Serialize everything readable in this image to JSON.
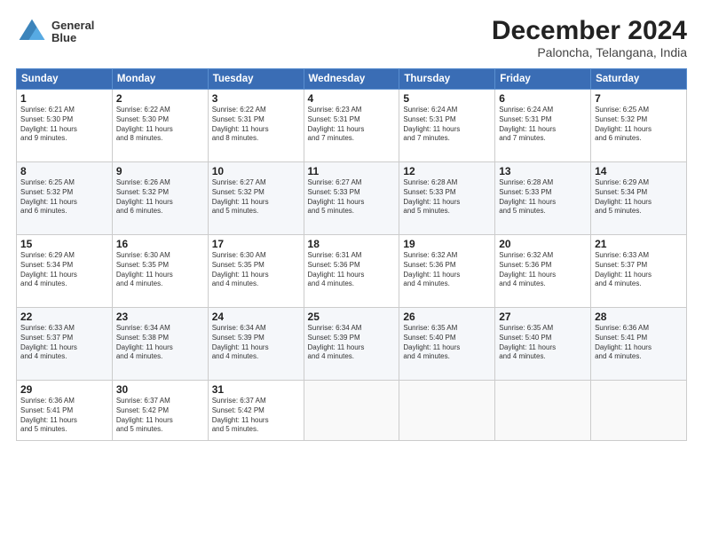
{
  "logo": {
    "line1": "General",
    "line2": "Blue"
  },
  "header": {
    "month": "December 2024",
    "location": "Paloncha, Telangana, India"
  },
  "weekdays": [
    "Sunday",
    "Monday",
    "Tuesday",
    "Wednesday",
    "Thursday",
    "Friday",
    "Saturday"
  ],
  "weeks": [
    [
      {
        "day": "1",
        "info": "Sunrise: 6:21 AM\nSunset: 5:30 PM\nDaylight: 11 hours\nand 9 minutes."
      },
      {
        "day": "2",
        "info": "Sunrise: 6:22 AM\nSunset: 5:30 PM\nDaylight: 11 hours\nand 8 minutes."
      },
      {
        "day": "3",
        "info": "Sunrise: 6:22 AM\nSunset: 5:31 PM\nDaylight: 11 hours\nand 8 minutes."
      },
      {
        "day": "4",
        "info": "Sunrise: 6:23 AM\nSunset: 5:31 PM\nDaylight: 11 hours\nand 7 minutes."
      },
      {
        "day": "5",
        "info": "Sunrise: 6:24 AM\nSunset: 5:31 PM\nDaylight: 11 hours\nand 7 minutes."
      },
      {
        "day": "6",
        "info": "Sunrise: 6:24 AM\nSunset: 5:31 PM\nDaylight: 11 hours\nand 7 minutes."
      },
      {
        "day": "7",
        "info": "Sunrise: 6:25 AM\nSunset: 5:32 PM\nDaylight: 11 hours\nand 6 minutes."
      }
    ],
    [
      {
        "day": "8",
        "info": "Sunrise: 6:25 AM\nSunset: 5:32 PM\nDaylight: 11 hours\nand 6 minutes."
      },
      {
        "day": "9",
        "info": "Sunrise: 6:26 AM\nSunset: 5:32 PM\nDaylight: 11 hours\nand 6 minutes."
      },
      {
        "day": "10",
        "info": "Sunrise: 6:27 AM\nSunset: 5:32 PM\nDaylight: 11 hours\nand 5 minutes."
      },
      {
        "day": "11",
        "info": "Sunrise: 6:27 AM\nSunset: 5:33 PM\nDaylight: 11 hours\nand 5 minutes."
      },
      {
        "day": "12",
        "info": "Sunrise: 6:28 AM\nSunset: 5:33 PM\nDaylight: 11 hours\nand 5 minutes."
      },
      {
        "day": "13",
        "info": "Sunrise: 6:28 AM\nSunset: 5:33 PM\nDaylight: 11 hours\nand 5 minutes."
      },
      {
        "day": "14",
        "info": "Sunrise: 6:29 AM\nSunset: 5:34 PM\nDaylight: 11 hours\nand 5 minutes."
      }
    ],
    [
      {
        "day": "15",
        "info": "Sunrise: 6:29 AM\nSunset: 5:34 PM\nDaylight: 11 hours\nand 4 minutes."
      },
      {
        "day": "16",
        "info": "Sunrise: 6:30 AM\nSunset: 5:35 PM\nDaylight: 11 hours\nand 4 minutes."
      },
      {
        "day": "17",
        "info": "Sunrise: 6:30 AM\nSunset: 5:35 PM\nDaylight: 11 hours\nand 4 minutes."
      },
      {
        "day": "18",
        "info": "Sunrise: 6:31 AM\nSunset: 5:36 PM\nDaylight: 11 hours\nand 4 minutes."
      },
      {
        "day": "19",
        "info": "Sunrise: 6:32 AM\nSunset: 5:36 PM\nDaylight: 11 hours\nand 4 minutes."
      },
      {
        "day": "20",
        "info": "Sunrise: 6:32 AM\nSunset: 5:36 PM\nDaylight: 11 hours\nand 4 minutes."
      },
      {
        "day": "21",
        "info": "Sunrise: 6:33 AM\nSunset: 5:37 PM\nDaylight: 11 hours\nand 4 minutes."
      }
    ],
    [
      {
        "day": "22",
        "info": "Sunrise: 6:33 AM\nSunset: 5:37 PM\nDaylight: 11 hours\nand 4 minutes."
      },
      {
        "day": "23",
        "info": "Sunrise: 6:34 AM\nSunset: 5:38 PM\nDaylight: 11 hours\nand 4 minutes."
      },
      {
        "day": "24",
        "info": "Sunrise: 6:34 AM\nSunset: 5:39 PM\nDaylight: 11 hours\nand 4 minutes."
      },
      {
        "day": "25",
        "info": "Sunrise: 6:34 AM\nSunset: 5:39 PM\nDaylight: 11 hours\nand 4 minutes."
      },
      {
        "day": "26",
        "info": "Sunrise: 6:35 AM\nSunset: 5:40 PM\nDaylight: 11 hours\nand 4 minutes."
      },
      {
        "day": "27",
        "info": "Sunrise: 6:35 AM\nSunset: 5:40 PM\nDaylight: 11 hours\nand 4 minutes."
      },
      {
        "day": "28",
        "info": "Sunrise: 6:36 AM\nSunset: 5:41 PM\nDaylight: 11 hours\nand 4 minutes."
      }
    ],
    [
      {
        "day": "29",
        "info": "Sunrise: 6:36 AM\nSunset: 5:41 PM\nDaylight: 11 hours\nand 5 minutes."
      },
      {
        "day": "30",
        "info": "Sunrise: 6:37 AM\nSunset: 5:42 PM\nDaylight: 11 hours\nand 5 minutes."
      },
      {
        "day": "31",
        "info": "Sunrise: 6:37 AM\nSunset: 5:42 PM\nDaylight: 11 hours\nand 5 minutes."
      },
      {
        "day": "",
        "info": ""
      },
      {
        "day": "",
        "info": ""
      },
      {
        "day": "",
        "info": ""
      },
      {
        "day": "",
        "info": ""
      }
    ]
  ]
}
